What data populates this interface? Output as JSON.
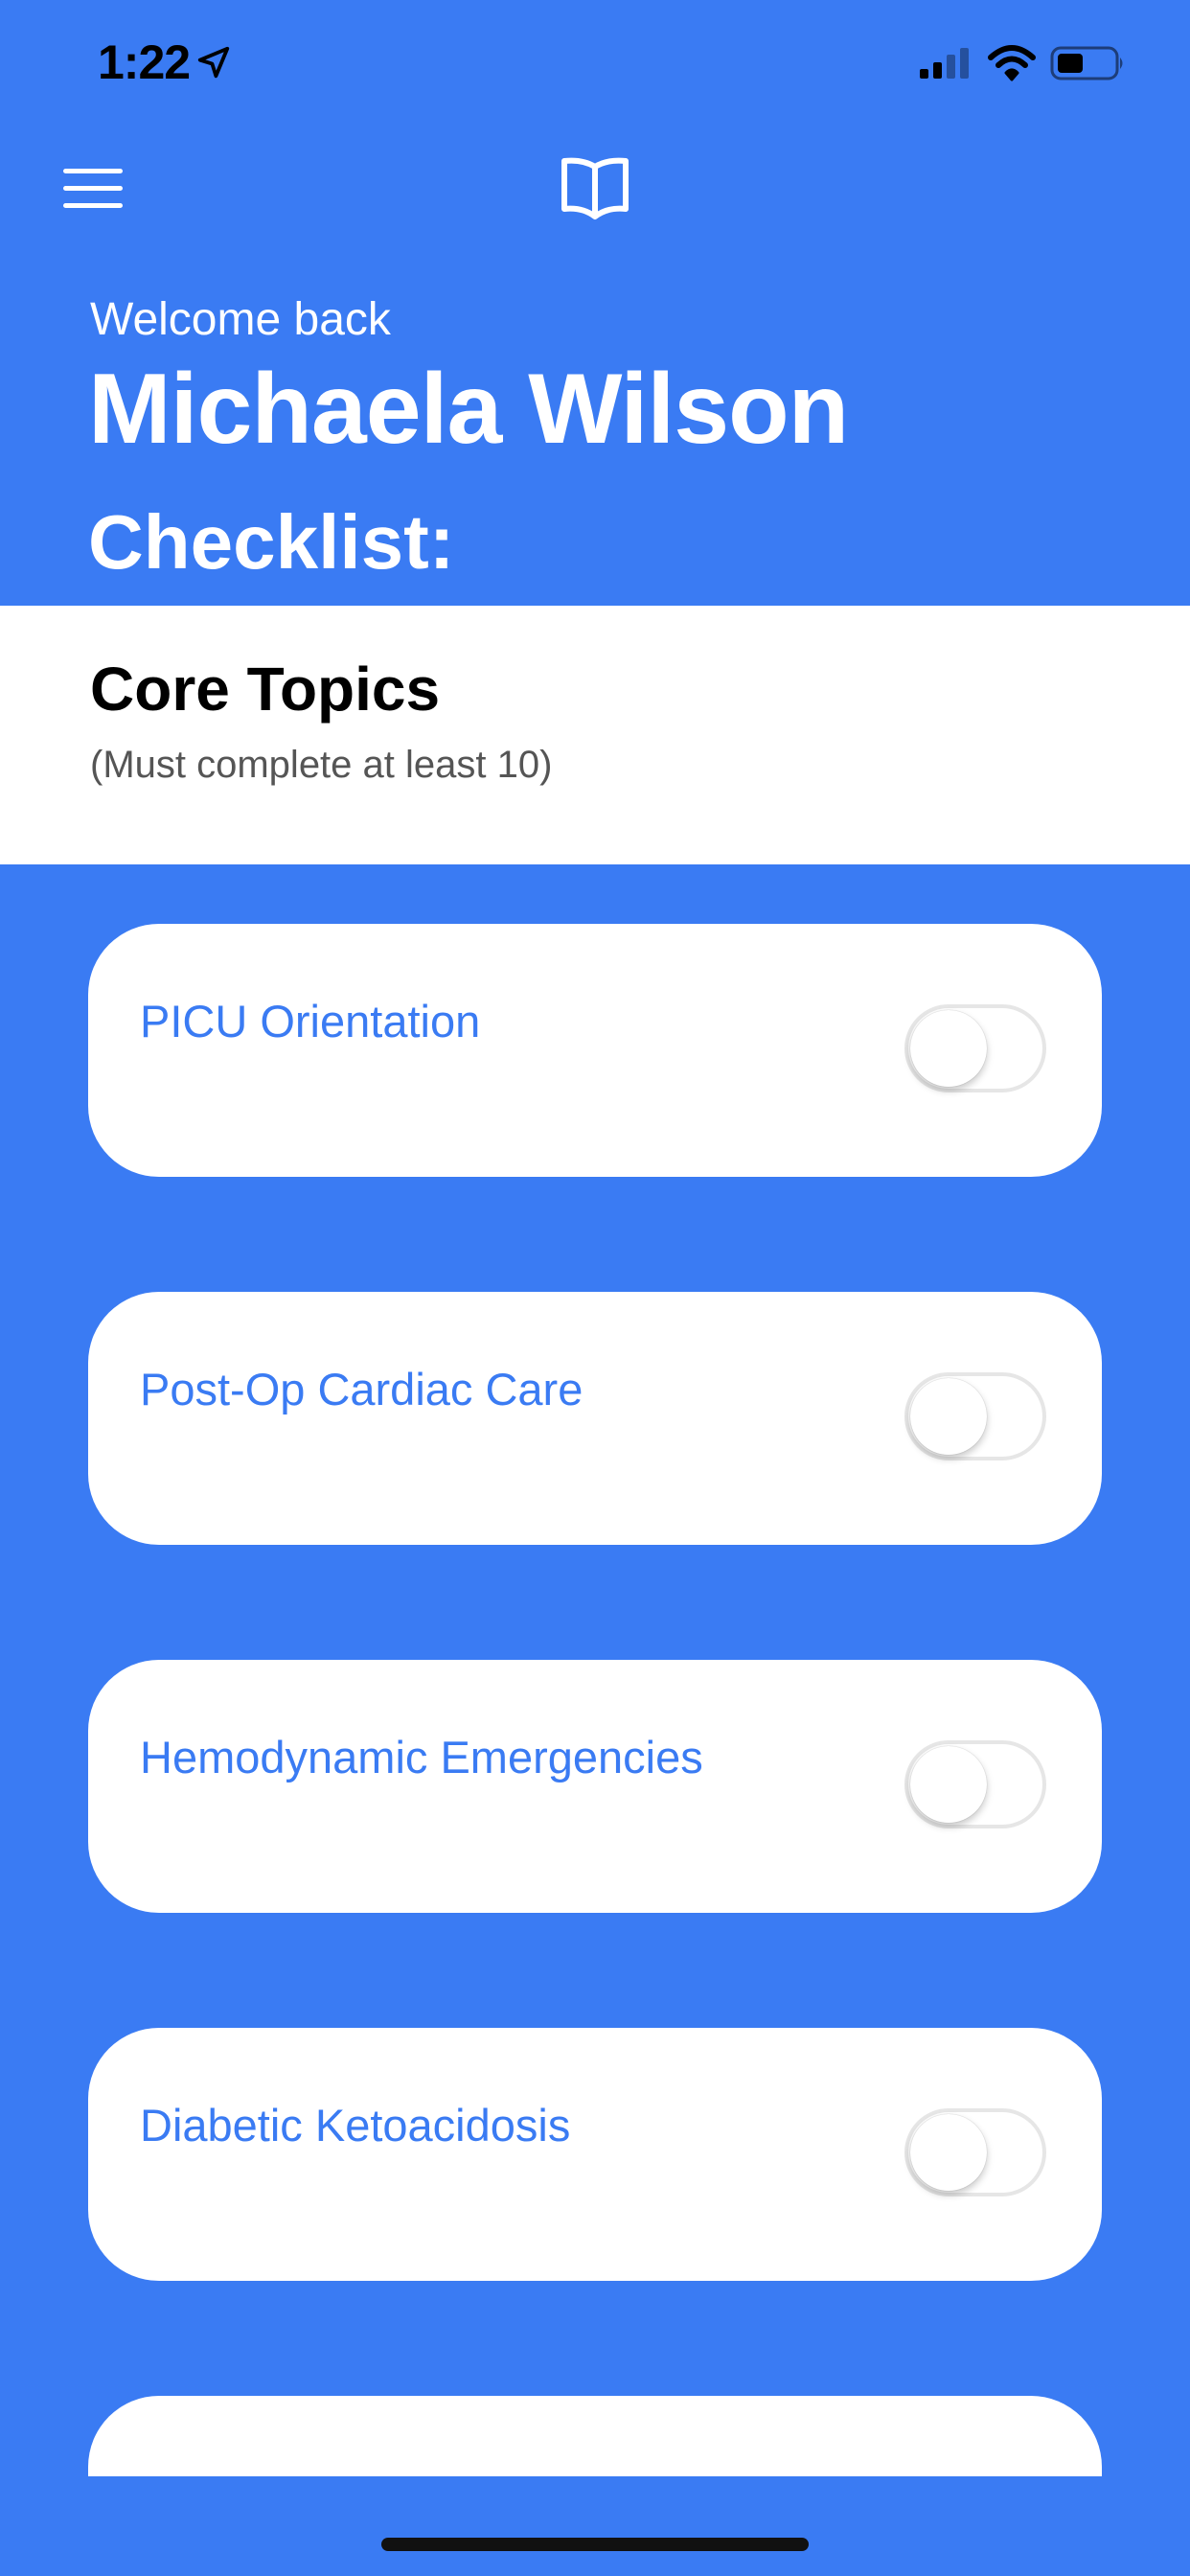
{
  "status_bar": {
    "time": "1:22"
  },
  "header": {
    "welcome": "Welcome back",
    "user_name": "Michaela Wilson",
    "checklist_heading": "Checklist:"
  },
  "section": {
    "title": "Core Topics",
    "subtitle": "(Must complete at least 10)"
  },
  "items": [
    {
      "label": "PICU Orientation",
      "checked": false
    },
    {
      "label": "Post-Op Cardiac Care",
      "checked": false
    },
    {
      "label": "Hemodynamic Emergencies",
      "checked": false
    },
    {
      "label": "Diabetic Ketoacidosis",
      "checked": false
    }
  ],
  "colors": {
    "background": "#3a7bf3",
    "accent_text": "#3a7bf3",
    "card": "#ffffff"
  },
  "icons": {
    "menu": "hamburger-menu-icon",
    "book": "open-book-icon",
    "location": "location-arrow-icon",
    "signal": "cellular-signal-icon",
    "wifi": "wifi-icon",
    "battery": "battery-icon"
  }
}
